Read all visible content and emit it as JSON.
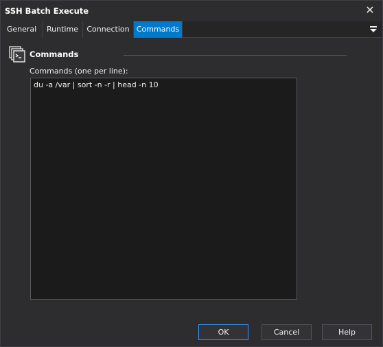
{
  "window": {
    "title": "SSH Batch Execute",
    "close_glyph": "✕"
  },
  "tabs": [
    {
      "label": "General",
      "active": false
    },
    {
      "label": "Runtime",
      "active": false
    },
    {
      "label": "Connection",
      "active": false
    },
    {
      "label": "Commands",
      "active": true
    }
  ],
  "tab_menu_icon": "dropdown-menu-icon",
  "section": {
    "title": "Commands",
    "icon": "terminal-windows-icon"
  },
  "commands_field": {
    "label": "Commands (one per line):",
    "value": "du -a /var | sort -n -r | head -n 10"
  },
  "buttons": {
    "ok": "OK",
    "cancel": "Cancel",
    "help": "Help"
  },
  "colors": {
    "accent": "#007acc",
    "background": "#2d2d30",
    "input_bg": "#1b1b1c"
  }
}
